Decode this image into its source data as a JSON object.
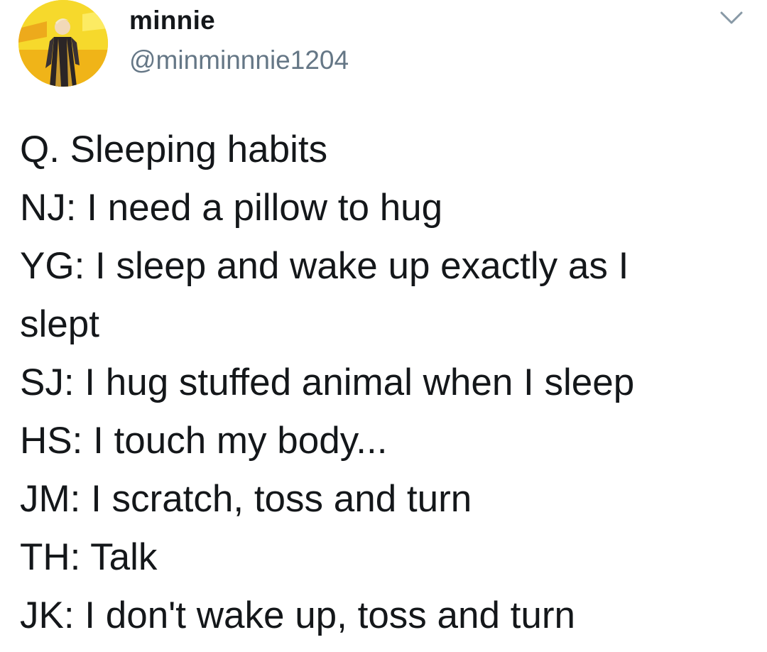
{
  "user": {
    "display_name": "minnie",
    "handle": "@minminnnie1204"
  },
  "icons": {
    "menu": "chevron-down-icon",
    "avatar": "avatar"
  },
  "tweet": {
    "lines": [
      "Q. Sleeping habits",
      "NJ: I need a pillow to hug",
      "YG: I sleep and wake up exactly as I",
      "slept",
      "SJ: I hug stuffed animal when I sleep",
      "HS: I touch my body...",
      "JM: I scratch, toss and turn",
      "TH: Talk",
      "JK: I don't wake up, toss and turn"
    ]
  },
  "colors": {
    "text": "#14171a",
    "secondary": "#657786",
    "background": "#ffffff"
  }
}
